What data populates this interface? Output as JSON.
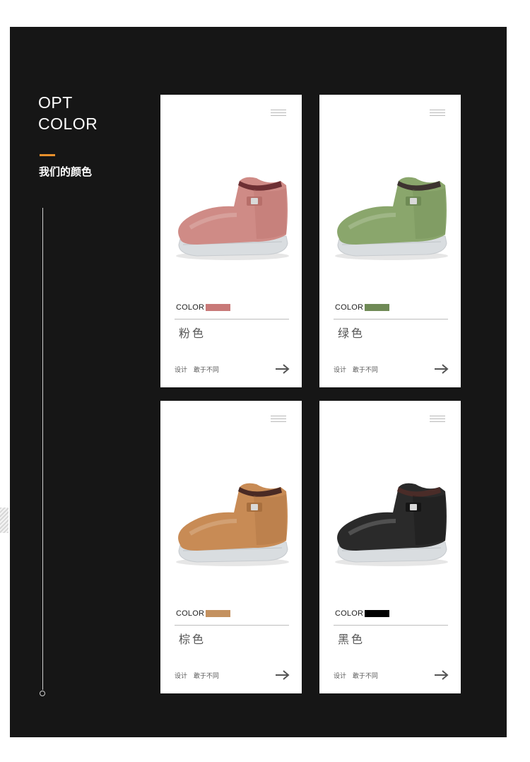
{
  "header": {
    "title_line1": "OPT",
    "title_line2": "COLOR",
    "subtitle": "我们的颜色"
  },
  "colors": {
    "background_panel": "#161616",
    "accent": "#e8902c"
  },
  "cards": [
    {
      "color_label": "COLOR",
      "swatch": "#c87978",
      "name": "粉色",
      "tagline": "设计 敢于不同",
      "shoe": {
        "upper": "#cf8b86",
        "dark": "#b76f6a",
        "lining": "#6d2f33"
      }
    },
    {
      "color_label": "COLOR",
      "swatch": "#6f8a56",
      "name": "绿色",
      "tagline": "设计 敢于不同",
      "shoe": {
        "upper": "#8aa66c",
        "dark": "#6f8b55",
        "lining": "#3d3330"
      }
    },
    {
      "color_label": "COLOR",
      "swatch": "#c4915f",
      "name": "棕色",
      "tagline": "设计 敢于不同",
      "shoe": {
        "upper": "#c88b55",
        "dark": "#a86f3e",
        "lining": "#4a2a24"
      }
    },
    {
      "color_label": "COLOR",
      "swatch": "#000000",
      "name": "黑色",
      "tagline": "设计 敢于不同",
      "shoe": {
        "upper": "#2a2a2a",
        "dark": "#151515",
        "lining": "#4a2c28"
      }
    }
  ]
}
